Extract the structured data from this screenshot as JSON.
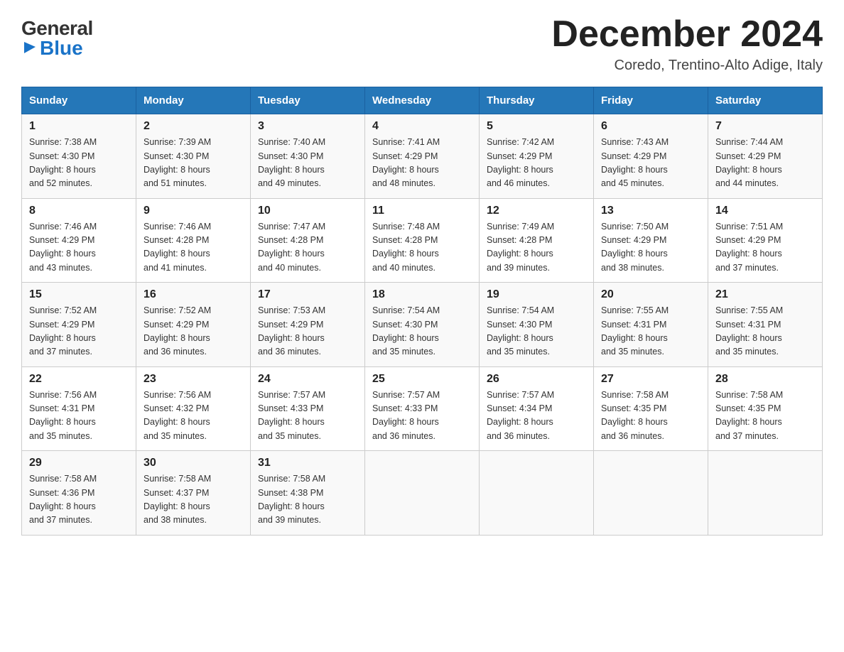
{
  "logo": {
    "general": "General",
    "blue": "Blue",
    "triangle": "▶"
  },
  "title": "December 2024",
  "location": "Coredo, Trentino-Alto Adige, Italy",
  "days_of_week": [
    "Sunday",
    "Monday",
    "Tuesday",
    "Wednesday",
    "Thursday",
    "Friday",
    "Saturday"
  ],
  "weeks": [
    [
      {
        "day": "1",
        "sunrise": "7:38 AM",
        "sunset": "4:30 PM",
        "daylight": "8 hours and 52 minutes."
      },
      {
        "day": "2",
        "sunrise": "7:39 AM",
        "sunset": "4:30 PM",
        "daylight": "8 hours and 51 minutes."
      },
      {
        "day": "3",
        "sunrise": "7:40 AM",
        "sunset": "4:30 PM",
        "daylight": "8 hours and 49 minutes."
      },
      {
        "day": "4",
        "sunrise": "7:41 AM",
        "sunset": "4:29 PM",
        "daylight": "8 hours and 48 minutes."
      },
      {
        "day": "5",
        "sunrise": "7:42 AM",
        "sunset": "4:29 PM",
        "daylight": "8 hours and 46 minutes."
      },
      {
        "day": "6",
        "sunrise": "7:43 AM",
        "sunset": "4:29 PM",
        "daylight": "8 hours and 45 minutes."
      },
      {
        "day": "7",
        "sunrise": "7:44 AM",
        "sunset": "4:29 PM",
        "daylight": "8 hours and 44 minutes."
      }
    ],
    [
      {
        "day": "8",
        "sunrise": "7:46 AM",
        "sunset": "4:29 PM",
        "daylight": "8 hours and 43 minutes."
      },
      {
        "day": "9",
        "sunrise": "7:46 AM",
        "sunset": "4:28 PM",
        "daylight": "8 hours and 41 minutes."
      },
      {
        "day": "10",
        "sunrise": "7:47 AM",
        "sunset": "4:28 PM",
        "daylight": "8 hours and 40 minutes."
      },
      {
        "day": "11",
        "sunrise": "7:48 AM",
        "sunset": "4:28 PM",
        "daylight": "8 hours and 40 minutes."
      },
      {
        "day": "12",
        "sunrise": "7:49 AM",
        "sunset": "4:28 PM",
        "daylight": "8 hours and 39 minutes."
      },
      {
        "day": "13",
        "sunrise": "7:50 AM",
        "sunset": "4:29 PM",
        "daylight": "8 hours and 38 minutes."
      },
      {
        "day": "14",
        "sunrise": "7:51 AM",
        "sunset": "4:29 PM",
        "daylight": "8 hours and 37 minutes."
      }
    ],
    [
      {
        "day": "15",
        "sunrise": "7:52 AM",
        "sunset": "4:29 PM",
        "daylight": "8 hours and 37 minutes."
      },
      {
        "day": "16",
        "sunrise": "7:52 AM",
        "sunset": "4:29 PM",
        "daylight": "8 hours and 36 minutes."
      },
      {
        "day": "17",
        "sunrise": "7:53 AM",
        "sunset": "4:29 PM",
        "daylight": "8 hours and 36 minutes."
      },
      {
        "day": "18",
        "sunrise": "7:54 AM",
        "sunset": "4:30 PM",
        "daylight": "8 hours and 35 minutes."
      },
      {
        "day": "19",
        "sunrise": "7:54 AM",
        "sunset": "4:30 PM",
        "daylight": "8 hours and 35 minutes."
      },
      {
        "day": "20",
        "sunrise": "7:55 AM",
        "sunset": "4:31 PM",
        "daylight": "8 hours and 35 minutes."
      },
      {
        "day": "21",
        "sunrise": "7:55 AM",
        "sunset": "4:31 PM",
        "daylight": "8 hours and 35 minutes."
      }
    ],
    [
      {
        "day": "22",
        "sunrise": "7:56 AM",
        "sunset": "4:31 PM",
        "daylight": "8 hours and 35 minutes."
      },
      {
        "day": "23",
        "sunrise": "7:56 AM",
        "sunset": "4:32 PM",
        "daylight": "8 hours and 35 minutes."
      },
      {
        "day": "24",
        "sunrise": "7:57 AM",
        "sunset": "4:33 PM",
        "daylight": "8 hours and 35 minutes."
      },
      {
        "day": "25",
        "sunrise": "7:57 AM",
        "sunset": "4:33 PM",
        "daylight": "8 hours and 36 minutes."
      },
      {
        "day": "26",
        "sunrise": "7:57 AM",
        "sunset": "4:34 PM",
        "daylight": "8 hours and 36 minutes."
      },
      {
        "day": "27",
        "sunrise": "7:58 AM",
        "sunset": "4:35 PM",
        "daylight": "8 hours and 36 minutes."
      },
      {
        "day": "28",
        "sunrise": "7:58 AM",
        "sunset": "4:35 PM",
        "daylight": "8 hours and 37 minutes."
      }
    ],
    [
      {
        "day": "29",
        "sunrise": "7:58 AM",
        "sunset": "4:36 PM",
        "daylight": "8 hours and 37 minutes."
      },
      {
        "day": "30",
        "sunrise": "7:58 AM",
        "sunset": "4:37 PM",
        "daylight": "8 hours and 38 minutes."
      },
      {
        "day": "31",
        "sunrise": "7:58 AM",
        "sunset": "4:38 PM",
        "daylight": "8 hours and 39 minutes."
      },
      null,
      null,
      null,
      null
    ]
  ]
}
